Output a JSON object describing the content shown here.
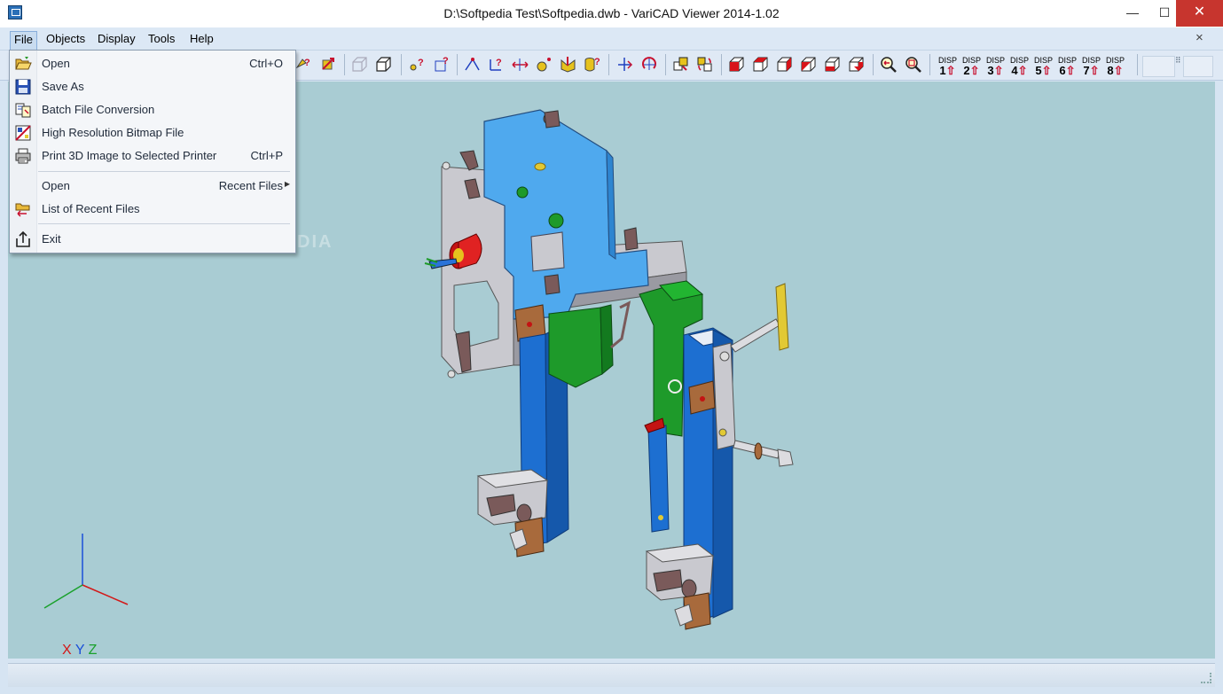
{
  "window": {
    "title": "D:\\Softpedia Test\\Softpedia.dwb - VariCAD Viewer 2014-1.02",
    "minimize_glyph": "—",
    "maximize_glyph": "☐",
    "close_glyph": "✕"
  },
  "menubar": {
    "items": [
      {
        "label": "File"
      },
      {
        "label": "Objects"
      },
      {
        "label": "Display"
      },
      {
        "label": "Tools"
      },
      {
        "label": "Help"
      }
    ],
    "close_glyph": "×"
  },
  "file_menu": {
    "items": [
      {
        "label": "Open",
        "shortcut": "Ctrl+O",
        "icon": "open-folder-icon"
      },
      {
        "label": "Save As",
        "shortcut": "",
        "icon": "save-as-icon"
      },
      {
        "label": "Batch File Conversion",
        "shortcut": "",
        "icon": "batch-convert-icon"
      },
      {
        "label": "High Resolution Bitmap File",
        "shortcut": "",
        "icon": "bitmap-file-icon"
      },
      {
        "label": "Print 3D Image to Selected Printer",
        "shortcut": "Ctrl+P",
        "icon": "printer-icon"
      },
      {
        "label": "Open",
        "shortcut": "Recent Files",
        "icon": ""
      },
      {
        "label": "List of Recent Files",
        "shortcut": "",
        "icon": "recent-files-icon"
      },
      {
        "label": "Exit",
        "shortcut": "",
        "icon": "exit-icon"
      }
    ],
    "submenu_arrow": "▶"
  },
  "toolbar": {
    "disp_buttons": [
      {
        "top": "DISP",
        "num": "1"
      },
      {
        "top": "DISP",
        "num": "2"
      },
      {
        "top": "DISP",
        "num": "3"
      },
      {
        "top": "DISP",
        "num": "4"
      },
      {
        "top": "DISP",
        "num": "5"
      },
      {
        "top": "DISP",
        "num": "6"
      },
      {
        "top": "DISP",
        "num": "7"
      },
      {
        "top": "DISP",
        "num": "8"
      }
    ],
    "disp_arrow": "⇧"
  },
  "viewport": {
    "watermark": "SOFTPEDIA",
    "axes": {
      "x": "X",
      "y": "Y",
      "z": "Z"
    },
    "colors": {
      "background": "#a9ccd3",
      "plate_blue": "#4fa9ee",
      "bar_blue": "#1d6fd1",
      "green": "#1e9a2a",
      "grey": "#c8c8cc",
      "bronze": "#a86a3c",
      "red": "#d21b14",
      "yellow": "#e2c934"
    }
  }
}
